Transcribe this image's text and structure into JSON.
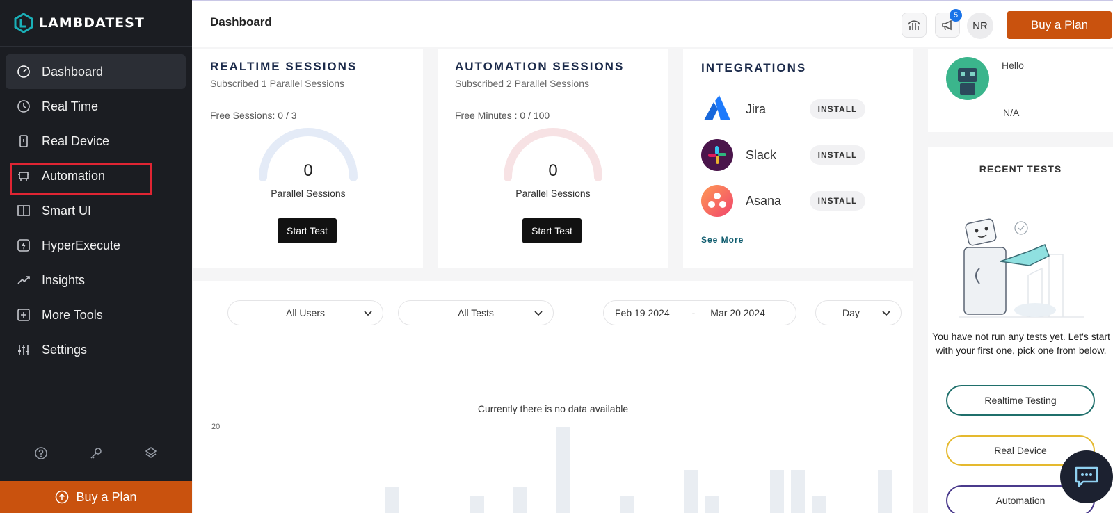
{
  "sidebar": {
    "logo_text": "LAMBDATEST",
    "items": [
      {
        "label": "Dashboard",
        "icon": "speedometer-icon"
      },
      {
        "label": "Real Time",
        "icon": "clock-icon"
      },
      {
        "label": "Real Device",
        "icon": "phone-icon"
      },
      {
        "label": "Automation",
        "icon": "robot-icon"
      },
      {
        "label": "Smart UI",
        "icon": "panels-icon"
      },
      {
        "label": "HyperExecute",
        "icon": "bolt-icon"
      },
      {
        "label": "Insights",
        "icon": "trend-icon"
      },
      {
        "label": "More Tools",
        "icon": "plus-square-icon"
      },
      {
        "label": "Settings",
        "icon": "sliders-icon"
      }
    ],
    "bottom_icons": [
      "help-icon",
      "key-icon",
      "layers-icon"
    ],
    "buy_label": "Buy a Plan"
  },
  "header": {
    "title": "Dashboard",
    "notification_count": "5",
    "user_initials": "NR",
    "buy_label": "Buy a Plan"
  },
  "realtime": {
    "title": "REALTIME SESSIONS",
    "subtitle": "Subscribed 1 Parallel Sessions",
    "free_text": "Free Sessions: 0 / 3",
    "value": "0",
    "value_label": "Parallel Sessions",
    "button": "Start Test"
  },
  "automation": {
    "title": "AUTOMATION SESSIONS",
    "subtitle": "Subscribed 2 Parallel Sessions",
    "free_text": "Free Minutes : 0 / 100",
    "value": "0",
    "value_label": "Parallel Sessions",
    "button": "Start Test"
  },
  "integrations": {
    "title": "INTEGRATIONS",
    "items": [
      {
        "name": "Jira",
        "action": "INSTALL"
      },
      {
        "name": "Slack",
        "action": "INSTALL"
      },
      {
        "name": "Asana",
        "action": "INSTALL"
      }
    ],
    "see_more": "See More"
  },
  "filters": {
    "users": "All Users",
    "tests": "All Tests",
    "date_from": "Feb 19 2024",
    "date_sep": "-",
    "date_to": "Mar 20 2024",
    "granularity": "Day"
  },
  "chart": {
    "no_data": "Currently there is no data available",
    "y_tick": "20"
  },
  "profile": {
    "greeting": "Hello",
    "name": "N/A"
  },
  "recent_tests": {
    "title": "RECENT TESTS",
    "empty_message": "You have not run any tests yet. Let's start with your first one, pick one from below.",
    "options": [
      {
        "label": "Realtime Testing",
        "color": "#1f6f6b"
      },
      {
        "label": "Real Device",
        "color": "#e5b92e"
      },
      {
        "label": "Automation",
        "color": "#4a3a8c"
      }
    ]
  }
}
